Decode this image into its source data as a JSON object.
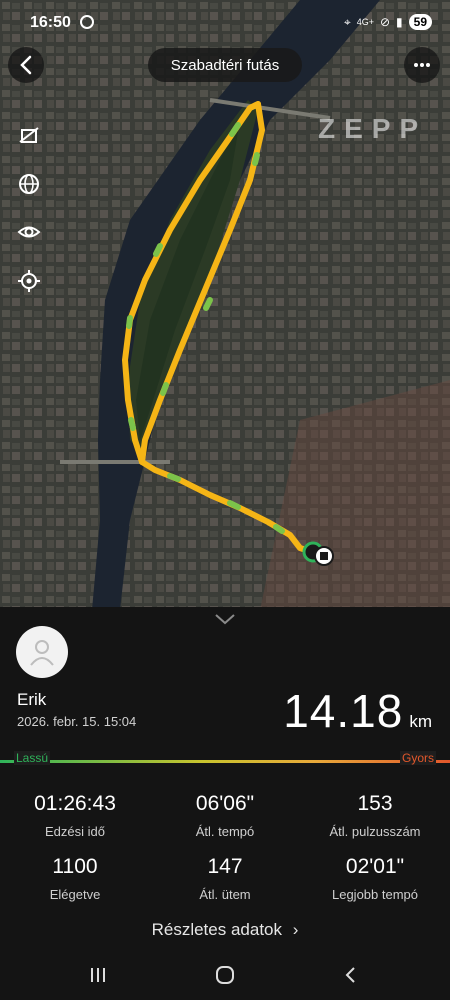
{
  "status_bar": {
    "time": "16:50",
    "network": "4G+",
    "battery": "59",
    "icons": [
      "data-saver-icon",
      "location-icon",
      "alarm-icon",
      "signal-icon",
      "battery-icon"
    ]
  },
  "header": {
    "title": "Szabadtéri futás",
    "back_icon": "back-arrow-icon",
    "more_icon": "more-icon"
  },
  "map": {
    "watermark": "ZEPP",
    "side_icons": [
      "satellite-toggle-icon",
      "globe-icon",
      "eye-icon",
      "locate-icon"
    ],
    "route_color": "#f5b516",
    "route_alt_color": "#7cc34a"
  },
  "user": {
    "name": "Erik",
    "date": "2026. febr. 15. 15:04"
  },
  "distance": {
    "value": "14.18",
    "unit": "km"
  },
  "speed_legend": {
    "slow": "Lassú",
    "fast": "Gyors"
  },
  "stats": [
    {
      "value": "01:26:43",
      "label": "Edzési idő"
    },
    {
      "value": "06'06\"",
      "label": "Átl. tempó"
    },
    {
      "value": "153",
      "label": "Átl. pulzusszám"
    },
    {
      "value": "1100",
      "label": "Elégetve"
    },
    {
      "value": "147",
      "label": "Átl. ütem"
    },
    {
      "value": "02'01\"",
      "label": "Legjobb tempó"
    }
  ],
  "details_link": "Részletes adatok",
  "nav": [
    "recent-apps-icon",
    "home-icon",
    "back-icon"
  ]
}
